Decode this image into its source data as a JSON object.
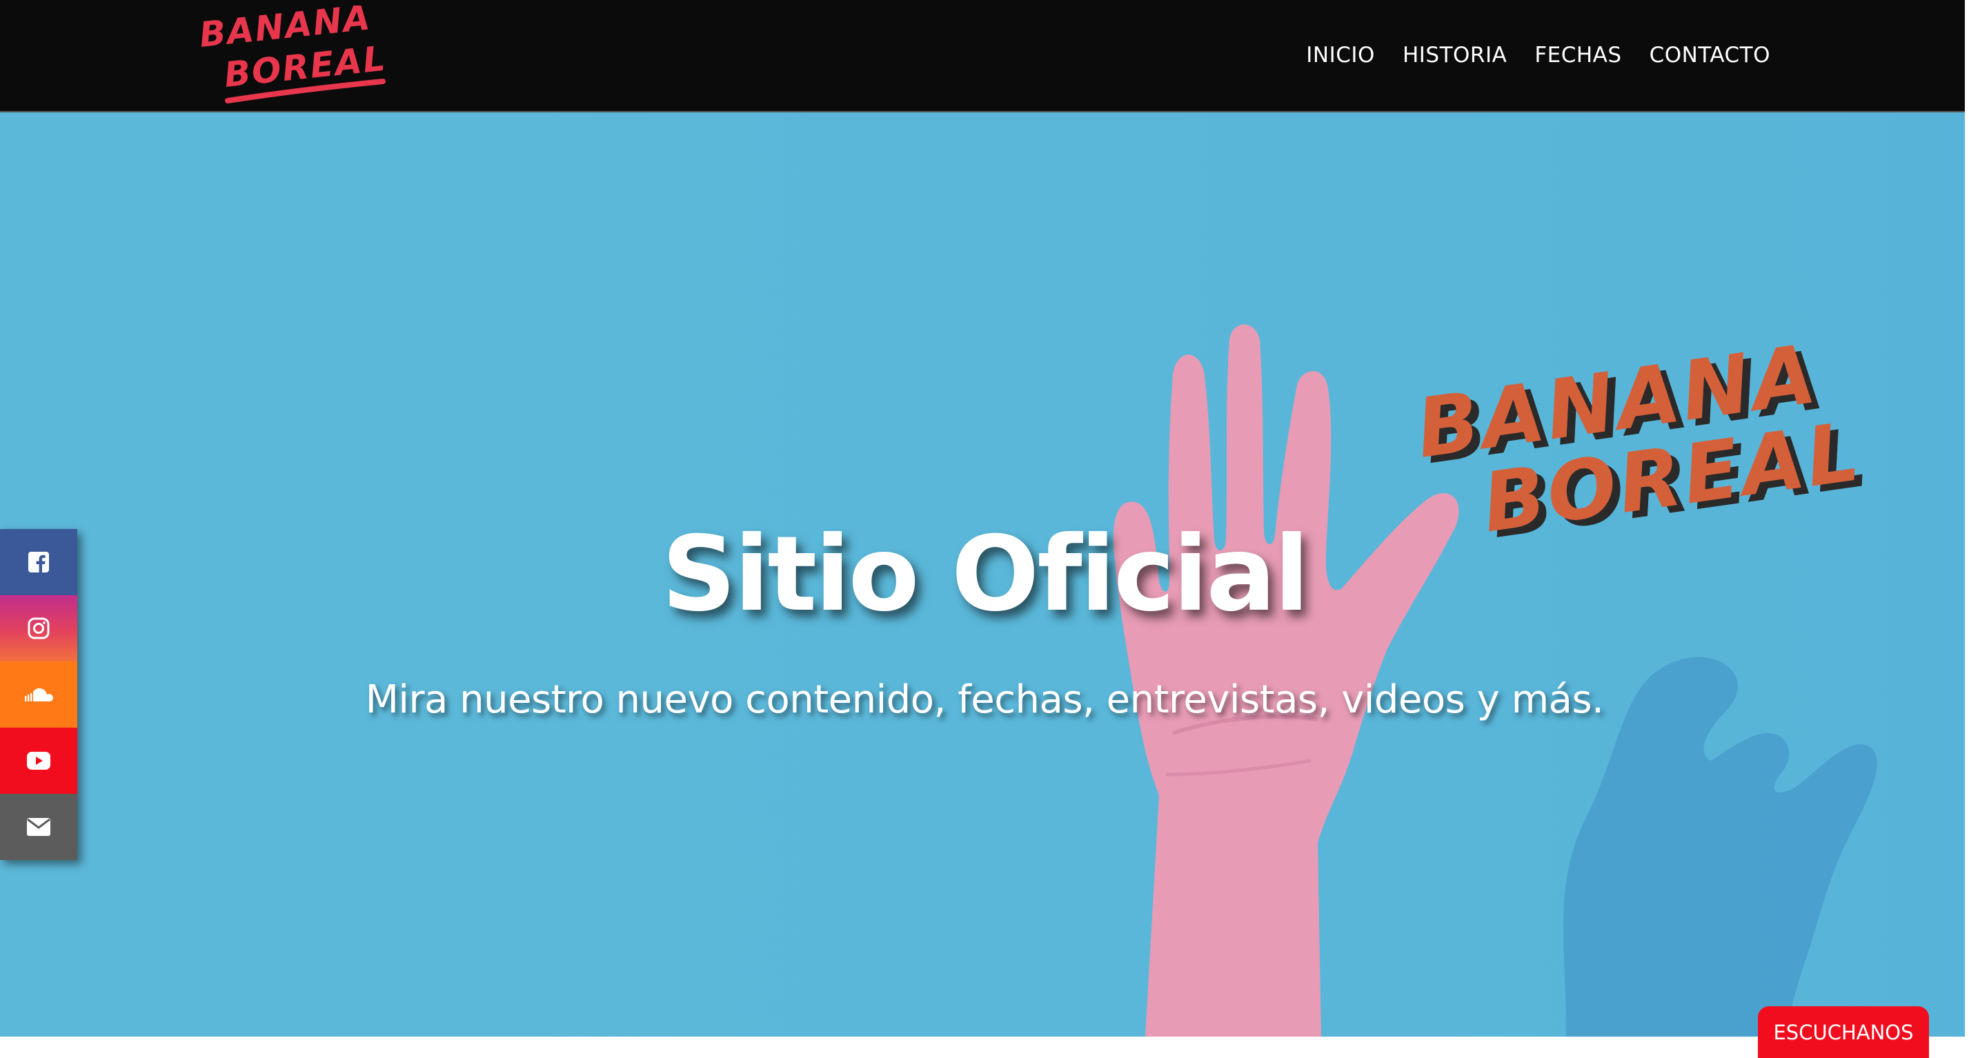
{
  "header": {
    "logo_text": "BANANA BOREAL",
    "nav": [
      {
        "label": "INICIO"
      },
      {
        "label": "HISTORIA"
      },
      {
        "label": "FECHAS"
      },
      {
        "label": "CONTACTO"
      }
    ]
  },
  "hero": {
    "title": "Sitio Oficial",
    "subtitle": "Mira nuestro nuevo contenido, fechas, entrevistas, videos y más.",
    "image_logo_text": "BANANA BOREAL",
    "background_color": "#5ab7d9"
  },
  "social_sidebar": [
    {
      "name": "facebook",
      "icon": "facebook-icon",
      "color": "#3b5998"
    },
    {
      "name": "instagram",
      "icon": "instagram-icon",
      "color": "#e3425c"
    },
    {
      "name": "soundcloud",
      "icon": "soundcloud-icon",
      "color": "#ff7a16"
    },
    {
      "name": "youtube",
      "icon": "youtube-icon",
      "color": "#f10d1d"
    },
    {
      "name": "email",
      "icon": "envelope-icon",
      "color": "#5c5c5c"
    }
  ],
  "listen_button": {
    "label": "ESCUCHANOS",
    "color": "#f10d1d"
  },
  "colors": {
    "header_bg": "#0b0b0b",
    "accent_red": "#e8364d",
    "logo_orange": "#d4603a"
  }
}
